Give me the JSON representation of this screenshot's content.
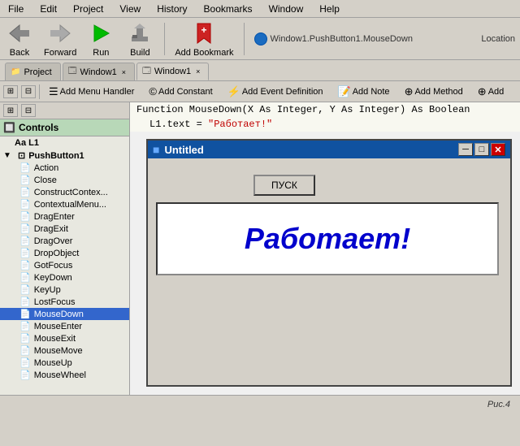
{
  "menubar": {
    "items": [
      "File",
      "Edit",
      "Project",
      "View",
      "History",
      "Bookmarks",
      "Window",
      "Help"
    ]
  },
  "toolbar": {
    "back_label": "Back",
    "forward_label": "Forward",
    "run_label": "Run",
    "build_label": "Build",
    "add_bookmark_label": "Add Bookmark",
    "location_text": "Window1.PushButton1.MouseDown",
    "location_label": "Location"
  },
  "tabs_row1": {
    "tabs": [
      {
        "label": "Project",
        "icon": "📁",
        "active": false
      },
      {
        "label": "Window1",
        "icon": "🪟",
        "active": false
      },
      {
        "label": "Window1",
        "icon": "🪟",
        "active": true
      }
    ]
  },
  "toolbar2": {
    "buttons": [
      {
        "label": "Add Menu Handler",
        "icon": "☰"
      },
      {
        "label": "Add Constant",
        "icon": "©"
      },
      {
        "label": "Add Event Definition",
        "icon": "⚡"
      },
      {
        "label": "Add Note",
        "icon": "📝"
      },
      {
        "label": "Add Method",
        "icon": "➕"
      },
      {
        "label": "Add",
        "icon": "➕"
      }
    ]
  },
  "left_panel": {
    "controls_label": "Controls",
    "aa_label": "Aa L1",
    "push_button_label": "PushButton1",
    "items": [
      "Action",
      "Close",
      "ConstructContex...",
      "ContextualMenu...",
      "DragEnter",
      "DragExit",
      "DragOver",
      "DropObject",
      "GotFocus",
      "KeyDown",
      "KeyUp",
      "LostFocus",
      "MouseDown",
      "MouseEnter",
      "MouseExit",
      "MouseMove",
      "MouseUp",
      "MouseWheel"
    ],
    "selected_item": "MouseDown"
  },
  "editor": {
    "line1": "Function MouseDown(X As Integer, Y As Integer) As Boolean",
    "line2_prefix": "L1.text = ",
    "line2_string": "\"Работает!\""
  },
  "preview": {
    "title": "Untitled",
    "title_icon": "■",
    "minimize_btn": "─",
    "maximize_btn": "□",
    "close_btn": "✕",
    "button_label": "ПУСК",
    "label_text": "Работает!"
  },
  "status_bar": {
    "caption": "Рис.4"
  }
}
